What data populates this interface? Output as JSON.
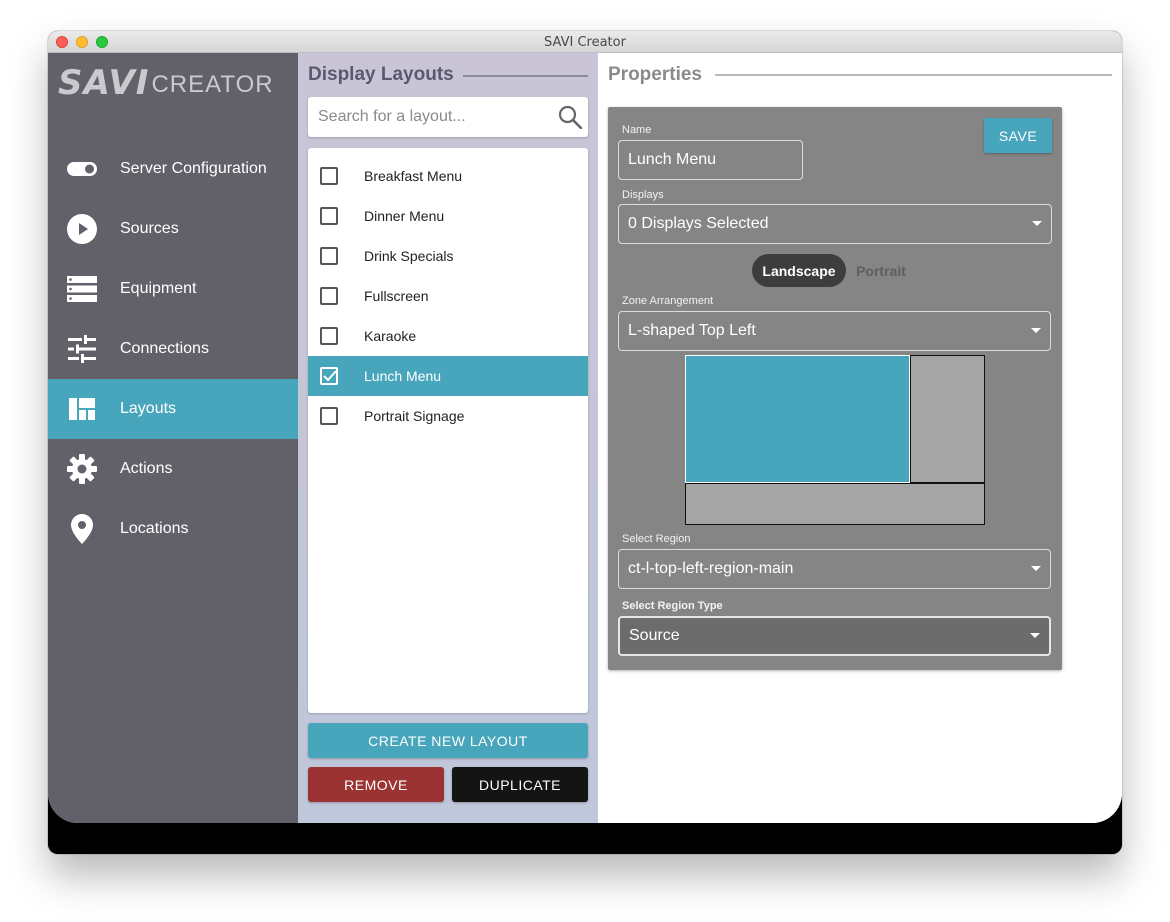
{
  "window": {
    "title": "SAVI Creator"
  },
  "sidebar": {
    "logo_main": "SAVI",
    "logo_sub": "CREATOR",
    "items": [
      {
        "label": "Server Configuration",
        "icon": "toggle-icon"
      },
      {
        "label": "Sources",
        "icon": "play-icon"
      },
      {
        "label": "Equipment",
        "icon": "server-rack-icon"
      },
      {
        "label": "Connections",
        "icon": "sliders-icon"
      },
      {
        "label": "Layouts",
        "icon": "layout-icon",
        "active": true
      },
      {
        "label": "Actions",
        "icon": "gear-icon"
      },
      {
        "label": "Locations",
        "icon": "location-pin-icon"
      }
    ]
  },
  "layouts_panel": {
    "title": "Display Layouts",
    "search_placeholder": "Search for a layout...",
    "items": [
      {
        "label": "Breakfast Menu",
        "checked": false
      },
      {
        "label": "Dinner Menu",
        "checked": false
      },
      {
        "label": "Drink Specials",
        "checked": false
      },
      {
        "label": "Fullscreen",
        "checked": false
      },
      {
        "label": "Karaoke",
        "checked": false
      },
      {
        "label": "Lunch Menu",
        "checked": true
      },
      {
        "label": "Portrait Signage",
        "checked": false
      }
    ],
    "create_label": "CREATE NEW LAYOUT",
    "remove_label": "REMOVE",
    "duplicate_label": "DUPLICATE"
  },
  "properties": {
    "title": "Properties",
    "save_label": "SAVE",
    "name_label": "Name",
    "name_value": "Lunch Menu",
    "displays_label": "Displays",
    "displays_value": "0 Displays Selected",
    "orientation": {
      "landscape": "Landscape",
      "portrait": "Portrait",
      "selected": "Landscape"
    },
    "zone_label": "Zone Arrangement",
    "zone_value": "L-shaped Top Left",
    "region_label": "Select Region",
    "region_value": "ct-l-top-left-region-main",
    "region_type_label": "Select Region Type",
    "region_type_value": "Source"
  },
  "colors": {
    "accent": "#48a6bc",
    "sidebar": "#626069",
    "remove": "#9a3331",
    "panel": "#858585"
  }
}
